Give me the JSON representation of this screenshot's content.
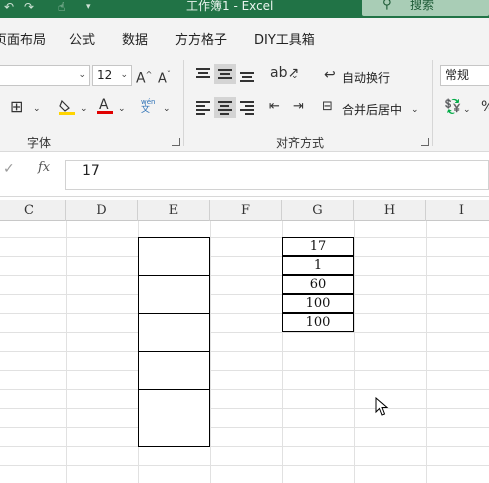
{
  "titlebar": {
    "title": "工作簿1  -  Excel",
    "search_label": "搜索"
  },
  "menu": {
    "tabs": [
      "页面布局",
      "公式",
      "数据",
      "方方格子",
      "DIY工具箱"
    ]
  },
  "ribbon": {
    "font_size": "12",
    "font_group_label": "字体",
    "align_group_label": "对齐方式",
    "wrap_text_label": "自动换行",
    "merge_center_label": "合并后居中",
    "number_format": "常规",
    "phonetic_glyph": "wén",
    "phonetic_char": "文"
  },
  "formula_bar": {
    "value": "17"
  },
  "columns": [
    "C",
    "D",
    "E",
    "F",
    "G",
    "H",
    "I"
  ],
  "cells": {
    "g_values": [
      "17",
      "1",
      "60",
      "100",
      "100"
    ]
  },
  "colors": {
    "title_bar": "#217346",
    "fill_color": "#ffd400",
    "font_color": "#e00000"
  }
}
